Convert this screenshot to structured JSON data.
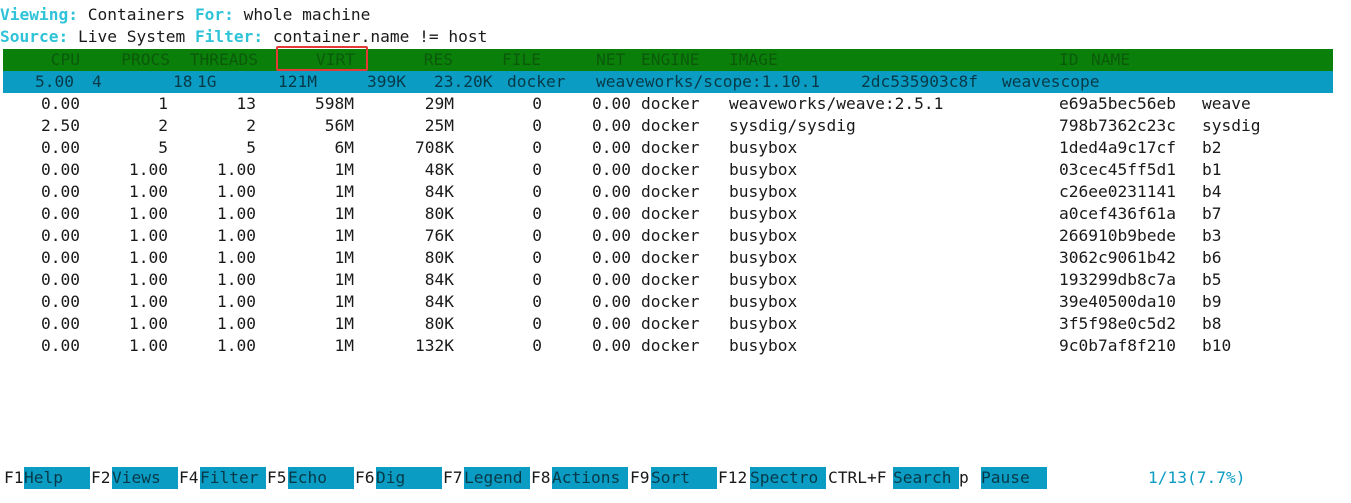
{
  "header": {
    "viewing_label": "Viewing:",
    "viewing_value": "Containers",
    "for_label": "For:",
    "for_value": "whole machine",
    "source_label": "Source:",
    "source_value": "Live System",
    "filter_label": "Filter:",
    "filter_value": "container.name != host"
  },
  "columns": [
    "CPU",
    "PROCS",
    "THREADS",
    "VIRT",
    "RES",
    "FILE",
    "NET",
    "ENGINE",
    "IMAGE",
    "ID",
    "NAME"
  ],
  "selected_row": {
    "cpu": "5.00",
    "procs": "4",
    "threads": "18",
    "virt": "1G",
    "res": "121M",
    "file": "399K",
    "net": "23.20K",
    "engine": "docker",
    "image": "weaveworks/scope:1.10.1",
    "id": "2dc535903c8f",
    "name": "weavescope"
  },
  "rows": [
    {
      "cpu": "0.00",
      "procs": "1",
      "threads": "13",
      "virt": "598M",
      "res": "29M",
      "file": "0",
      "net": "0.00",
      "engine": "docker",
      "image": "weaveworks/weave:2.5.1",
      "id": "e69a5bec56eb",
      "name": "weave"
    },
    {
      "cpu": "2.50",
      "procs": "2",
      "threads": "2",
      "virt": "56M",
      "res": "25M",
      "file": "0",
      "net": "0.00",
      "engine": "docker",
      "image": "sysdig/sysdig",
      "id": "798b7362c23c",
      "name": "sysdig"
    },
    {
      "cpu": "0.00",
      "procs": "5",
      "threads": "5",
      "virt": "6M",
      "res": "708K",
      "file": "0",
      "net": "0.00",
      "engine": "docker",
      "image": "busybox",
      "id": "1ded4a9c17cf",
      "name": "b2"
    },
    {
      "cpu": "0.00",
      "procs": "1.00",
      "threads": "1.00",
      "virt": "1M",
      "res": "48K",
      "file": "0",
      "net": "0.00",
      "engine": "docker",
      "image": "busybox",
      "id": "03cec45ff5d1",
      "name": "b1"
    },
    {
      "cpu": "0.00",
      "procs": "1.00",
      "threads": "1.00",
      "virt": "1M",
      "res": "84K",
      "file": "0",
      "net": "0.00",
      "engine": "docker",
      "image": "busybox",
      "id": "c26ee0231141",
      "name": "b4"
    },
    {
      "cpu": "0.00",
      "procs": "1.00",
      "threads": "1.00",
      "virt": "1M",
      "res": "80K",
      "file": "0",
      "net": "0.00",
      "engine": "docker",
      "image": "busybox",
      "id": "a0cef436f61a",
      "name": "b7"
    },
    {
      "cpu": "0.00",
      "procs": "1.00",
      "threads": "1.00",
      "virt": "1M",
      "res": "76K",
      "file": "0",
      "net": "0.00",
      "engine": "docker",
      "image": "busybox",
      "id": "266910b9bede",
      "name": "b3"
    },
    {
      "cpu": "0.00",
      "procs": "1.00",
      "threads": "1.00",
      "virt": "1M",
      "res": "80K",
      "file": "0",
      "net": "0.00",
      "engine": "docker",
      "image": "busybox",
      "id": "3062c9061b42",
      "name": "b6"
    },
    {
      "cpu": "0.00",
      "procs": "1.00",
      "threads": "1.00",
      "virt": "1M",
      "res": "84K",
      "file": "0",
      "net": "0.00",
      "engine": "docker",
      "image": "busybox",
      "id": "193299db8c7a",
      "name": "b5"
    },
    {
      "cpu": "0.00",
      "procs": "1.00",
      "threads": "1.00",
      "virt": "1M",
      "res": "84K",
      "file": "0",
      "net": "0.00",
      "engine": "docker",
      "image": "busybox",
      "id": "39e40500da10",
      "name": "b9"
    },
    {
      "cpu": "0.00",
      "procs": "1.00",
      "threads": "1.00",
      "virt": "1M",
      "res": "80K",
      "file": "0",
      "net": "0.00",
      "engine": "docker",
      "image": "busybox",
      "id": "3f5f98e0c5d2",
      "name": "b8"
    },
    {
      "cpu": "0.00",
      "procs": "1.00",
      "threads": "1.00",
      "virt": "1M",
      "res": "132K",
      "file": "0",
      "net": "0.00",
      "engine": "docker",
      "image": "busybox",
      "id": "9c0b7af8f210",
      "name": "b10"
    }
  ],
  "fkeys": [
    {
      "key": "F1",
      "label": "Help"
    },
    {
      "key": "F2",
      "label": "Views"
    },
    {
      "key": "F4",
      "label": "Filter"
    },
    {
      "key": "F5",
      "label": "Echo"
    },
    {
      "key": "F6",
      "label": "Dig"
    },
    {
      "key": "F7",
      "label": "Legend"
    },
    {
      "key": "F8",
      "label": "Actions"
    },
    {
      "key": "F9",
      "label": "Sort"
    },
    {
      "key": "F12",
      "label": "Spectro"
    },
    {
      "key": "CTRL+F",
      "label": "Search"
    },
    {
      "key": "p",
      "label": "Pause"
    }
  ],
  "pager": "1/13(7.7%)",
  "colors": {
    "header_bg": "#0a7f0a",
    "selected_bg": "#0b9cc4",
    "label_cyan": "#2ec3d8",
    "highlight_box": "#e53935"
  }
}
